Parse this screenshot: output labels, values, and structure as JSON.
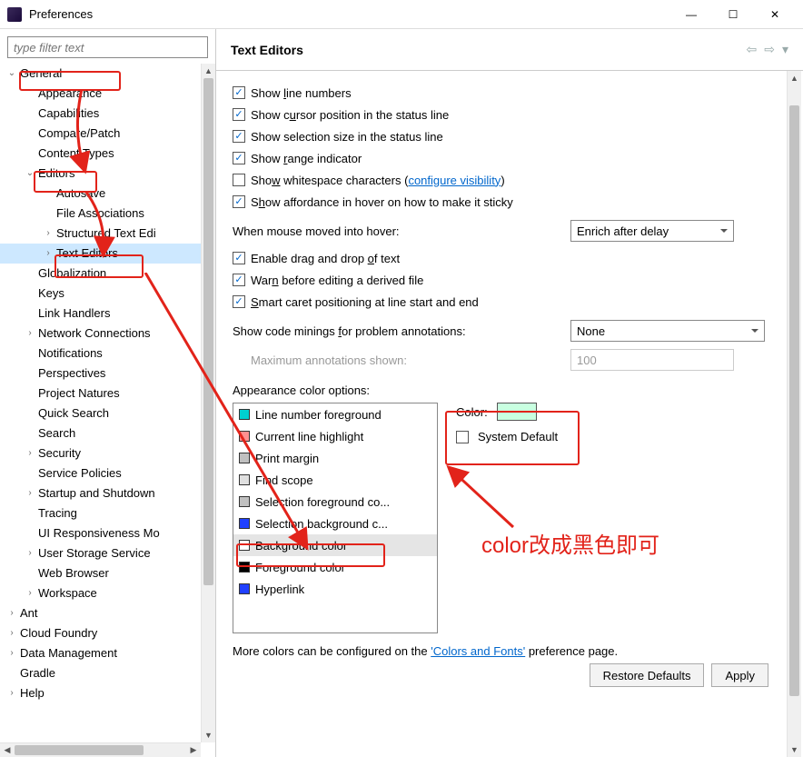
{
  "window": {
    "title": "Preferences",
    "minimize": "—",
    "maximize": "☐",
    "close": "✕"
  },
  "filter": {
    "placeholder": "type filter text"
  },
  "tree": [
    {
      "level": 0,
      "exp": "open",
      "label": "General"
    },
    {
      "level": 1,
      "exp": "none",
      "label": "Appearance"
    },
    {
      "level": 1,
      "exp": "none",
      "label": "Capabilities"
    },
    {
      "level": 1,
      "exp": "none",
      "label": "Compare/Patch"
    },
    {
      "level": 1,
      "exp": "none",
      "label": "Content Types"
    },
    {
      "level": 1,
      "exp": "open",
      "label": "Editors"
    },
    {
      "level": 2,
      "exp": "none",
      "label": "Autosave"
    },
    {
      "level": 2,
      "exp": "none",
      "label": "File Associations"
    },
    {
      "level": 2,
      "exp": "closed",
      "label": "Structured Text Edi"
    },
    {
      "level": 2,
      "exp": "closed",
      "label": "Text Editors",
      "selected": true
    },
    {
      "level": 1,
      "exp": "none",
      "label": "Globalization"
    },
    {
      "level": 1,
      "exp": "none",
      "label": "Keys"
    },
    {
      "level": 1,
      "exp": "none",
      "label": "Link Handlers"
    },
    {
      "level": 1,
      "exp": "closed",
      "label": "Network Connections"
    },
    {
      "level": 1,
      "exp": "none",
      "label": "Notifications"
    },
    {
      "level": 1,
      "exp": "none",
      "label": "Perspectives"
    },
    {
      "level": 1,
      "exp": "none",
      "label": "Project Natures"
    },
    {
      "level": 1,
      "exp": "none",
      "label": "Quick Search"
    },
    {
      "level": 1,
      "exp": "none",
      "label": "Search"
    },
    {
      "level": 1,
      "exp": "closed",
      "label": "Security"
    },
    {
      "level": 1,
      "exp": "none",
      "label": "Service Policies"
    },
    {
      "level": 1,
      "exp": "closed",
      "label": "Startup and Shutdown"
    },
    {
      "level": 1,
      "exp": "none",
      "label": "Tracing"
    },
    {
      "level": 1,
      "exp": "none",
      "label": "UI Responsiveness Mo"
    },
    {
      "level": 1,
      "exp": "closed",
      "label": "User Storage Service"
    },
    {
      "level": 1,
      "exp": "none",
      "label": "Web Browser"
    },
    {
      "level": 1,
      "exp": "closed",
      "label": "Workspace"
    },
    {
      "level": 0,
      "exp": "closed",
      "label": "Ant"
    },
    {
      "level": 0,
      "exp": "closed",
      "label": "Cloud Foundry"
    },
    {
      "level": 0,
      "exp": "closed",
      "label": "Data Management"
    },
    {
      "level": 0,
      "exp": "none",
      "label": "Gradle"
    },
    {
      "level": 0,
      "exp": "closed",
      "label": "Help"
    }
  ],
  "page": {
    "title": "Text Editors",
    "nav_back": "⇦",
    "nav_fwd": "⇨",
    "nav_menu": "▾"
  },
  "checks": {
    "line_numbers_pre": "Show ",
    "line_numbers_mid": "l",
    "line_numbers_post": "ine numbers",
    "cursor_pos_pre": "Show c",
    "cursor_pos_mid": "u",
    "cursor_pos_post": "rsor position in the status line",
    "sel_size": "Show selection size in the status line",
    "range_pre": "Show ",
    "range_mid": "r",
    "range_post": "ange indicator",
    "whitespace_pre": "Sho",
    "whitespace_mid": "w",
    "whitespace_post": " whitespace characters (",
    "whitespace_link": "configure visibility",
    "whitespace_close": ")",
    "affordance_pre": "S",
    "affordance_mid": "h",
    "affordance_post": "ow affordance in hover on how to make it sticky",
    "dnd_pre": "Enable drag and drop ",
    "dnd_mid": "o",
    "dnd_post": "f text",
    "warn_pre": "War",
    "warn_mid": "n",
    "warn_post": " before editing a derived file",
    "smart_pre": "",
    "smart_mid": "S",
    "smart_post": "mart caret positioning at line start and end"
  },
  "hover": {
    "label": "When mouse moved into hover:",
    "value": "Enrich after delay"
  },
  "minings": {
    "label_pre": "Show code minings ",
    "label_mid": "f",
    "label_post": "or problem annotations:",
    "value": "None",
    "max_label": "Maximum annotations shown:",
    "max_value": "100"
  },
  "appearance": {
    "label": "Appearance color options:",
    "items": [
      {
        "color": "#00d0d0",
        "label": "Line number foreground"
      },
      {
        "color": "#ff9090",
        "label": "Current line highlight"
      },
      {
        "color": "#c0c0c0",
        "label": "Print margin"
      },
      {
        "color": "#e0e0e0",
        "label": "Find scope"
      },
      {
        "color": "#c0c0c0",
        "label": "Selection foreground co..."
      },
      {
        "color": "#2040ff",
        "label": "Selection background c..."
      },
      {
        "color": "#ffffff",
        "label": "Background color",
        "selected": true
      },
      {
        "color": "#000000",
        "label": "Foreground color"
      },
      {
        "color": "#2040ff",
        "label": "Hyperlink"
      }
    ],
    "color_label": "Color:",
    "color_value": "#c8ffe0",
    "sysdef_label": "System Default"
  },
  "more": {
    "pre": "More colors can be configured on the ",
    "link": "'Colors and Fonts'",
    "post": " preference page."
  },
  "buttons": {
    "restore": "Restore Defaults",
    "apply": "Apply"
  },
  "annotation": {
    "text": "color改成黑色即可"
  }
}
